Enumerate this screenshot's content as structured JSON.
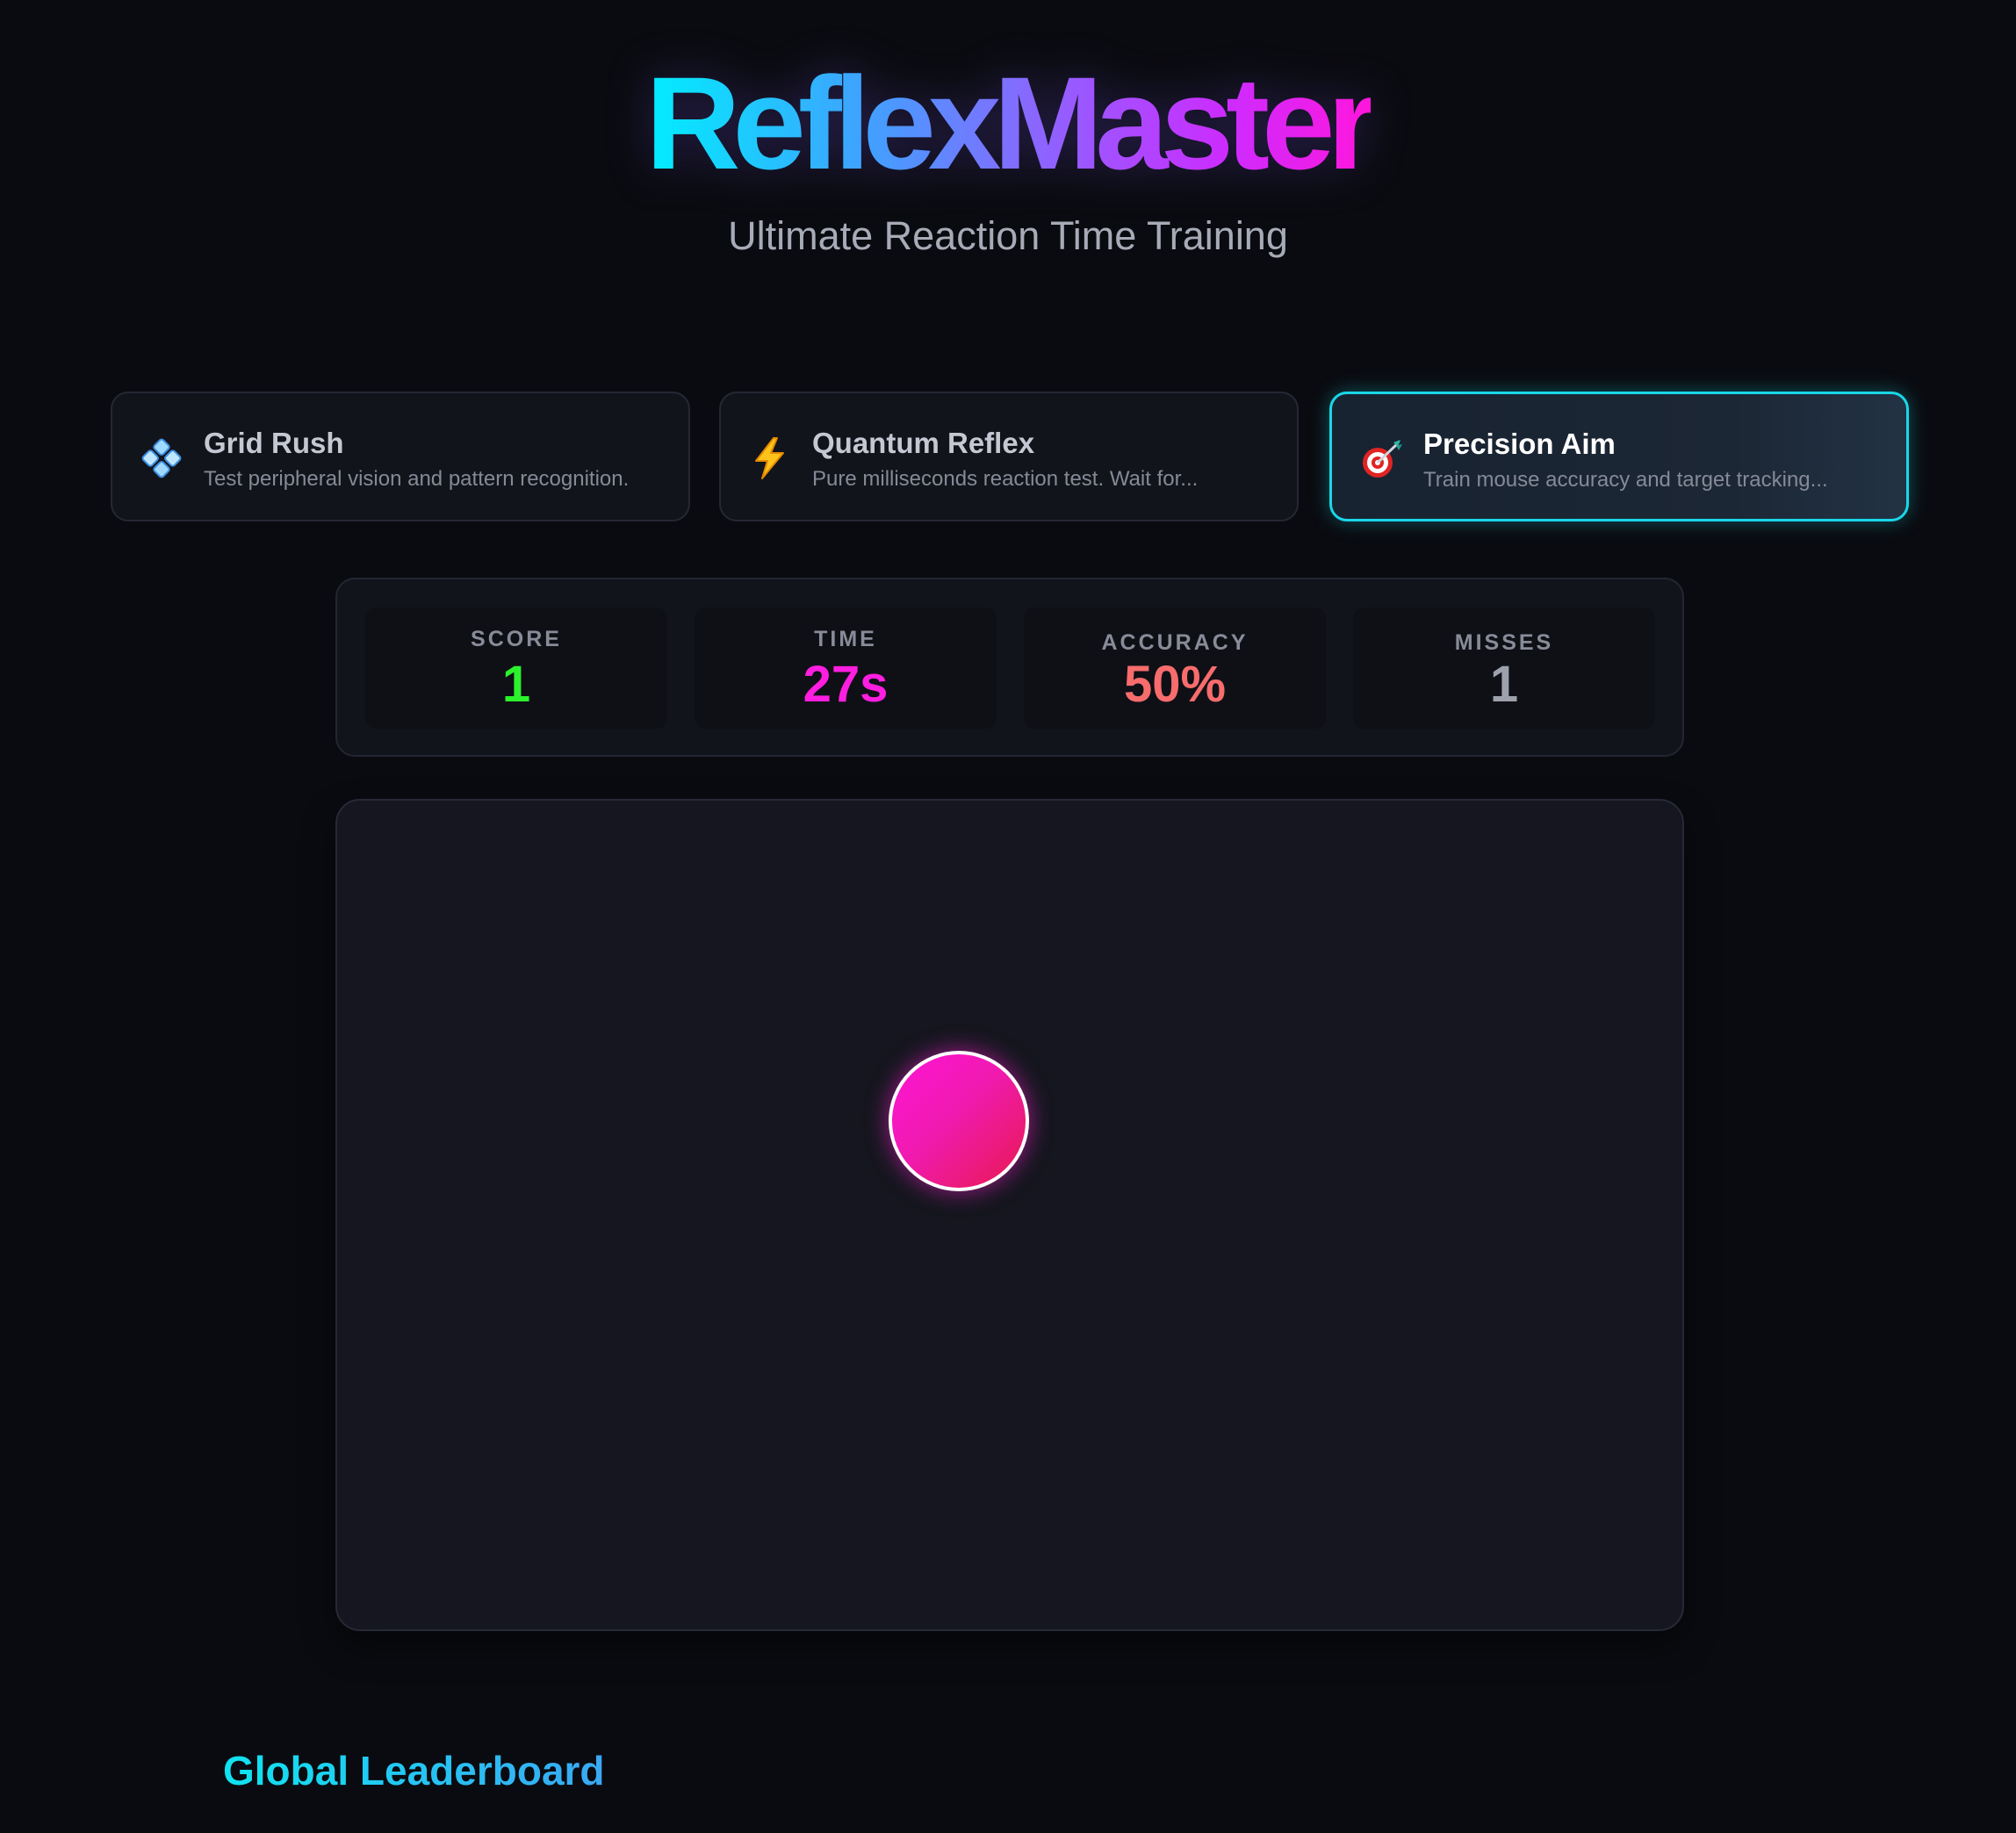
{
  "header": {
    "title": "ReflexMaster",
    "subtitle": "Ultimate Reaction Time Training"
  },
  "modes": [
    {
      "name": "Grid Rush",
      "description": "Test peripheral vision and pattern recognition.",
      "icon": "grid-diamond-icon",
      "active": false
    },
    {
      "name": "Quantum Reflex",
      "description": "Pure milliseconds reaction test. Wait for...",
      "icon": "lightning-icon",
      "active": false
    },
    {
      "name": "Precision Aim",
      "description": "Train mouse accuracy and target tracking...",
      "icon": "target-dart-icon",
      "active": true
    }
  ],
  "stats": {
    "score": {
      "label": "SCORE",
      "value": "1",
      "color": "#2cf22c"
    },
    "time": {
      "label": "TIME",
      "value": "27s",
      "color": "#ff1ee0"
    },
    "accuracy": {
      "label": "ACCURACY",
      "value": "50%",
      "color": "#f76c6c"
    },
    "misses": {
      "label": "MISSES",
      "value": "1",
      "color": "#9da1ac"
    }
  },
  "leaderboard": {
    "title": "Global Leaderboard"
  },
  "colors": {
    "accent_cyan": "#19d7e8",
    "accent_magenta": "#ff16dc",
    "target_start": "#ff14d5",
    "target_end": "#e8194f"
  }
}
